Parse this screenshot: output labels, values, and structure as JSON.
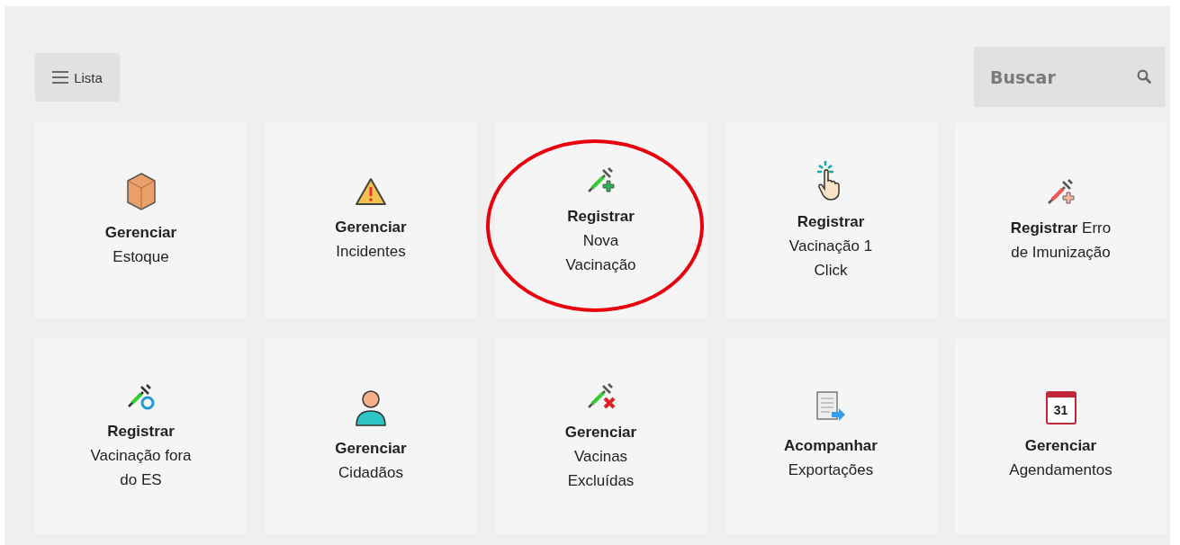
{
  "menu_button": {
    "label": "Lista"
  },
  "search": {
    "placeholder": "Buscar"
  },
  "tiles": [
    {
      "kind": "box",
      "lines": [
        "**Gerenciar**",
        "Estoque"
      ],
      "highlighted": false
    },
    {
      "kind": "warning",
      "lines": [
        "**Gerenciar**",
        "Incidentes"
      ],
      "highlighted": false
    },
    {
      "kind": "syringe-plus",
      "lines": [
        "**Registrar**",
        "Nova",
        "Vacinação"
      ],
      "highlighted": true
    },
    {
      "kind": "click",
      "lines": [
        "**Registrar**",
        "Vacinação 1",
        "Click"
      ],
      "highlighted": false
    },
    {
      "kind": "syringe-error",
      "lines": [
        "**Registrar** Erro",
        "de Imunização"
      ],
      "highlighted": false
    },
    {
      "kind": "syringe-return",
      "lines": [
        "**Registrar**",
        "Vacinação fora",
        "do ES"
      ],
      "highlighted": false
    },
    {
      "kind": "person",
      "lines": [
        "**Gerenciar**",
        "Cidadãos"
      ],
      "highlighted": false
    },
    {
      "kind": "syringe-x",
      "lines": [
        "**Gerenciar**",
        "Vacinas",
        "Excluídas"
      ],
      "highlighted": false
    },
    {
      "kind": "export",
      "lines": [
        "**Acompanhar**",
        "Exportações"
      ],
      "highlighted": false
    },
    {
      "kind": "calendar",
      "icon_text": "31",
      "lines": [
        "**Gerenciar**",
        "Agendamentos"
      ],
      "highlighted": false
    }
  ]
}
